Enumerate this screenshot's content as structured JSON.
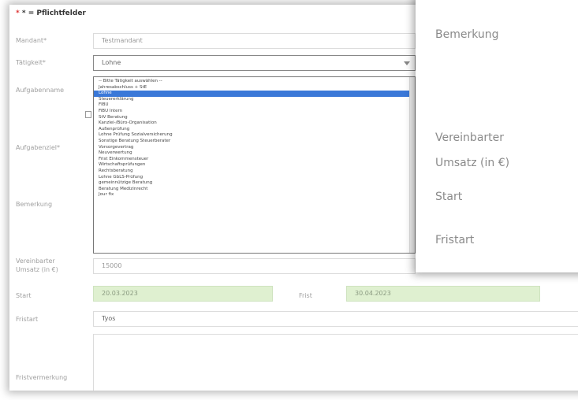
{
  "form": {
    "required_note": "* = Pflichtfelder",
    "labels": {
      "mandant": "Mandant*",
      "taetigkeit": "Tätigkeit*",
      "aufgabenname": "Aufgabenname",
      "aufgabenziel": "Aufgabenziel*",
      "bemerkung": "Bemerkung",
      "umsatz": "Vereinbarter Umsatz (in €)",
      "start": "Start",
      "fristart": "Fristart",
      "fristvermerkung": "Fristvermerkung"
    },
    "values": {
      "mandant": "Testmandant",
      "taetigkeit": "Lohne",
      "umsatz": "15000",
      "start": "20.03.2023",
      "frist_label": "Frist",
      "frist": "30.04.2023",
      "fristart": "Tyos"
    }
  },
  "dropdown": {
    "selected_index": 2,
    "options": [
      "-- Bitte Tätigkeit auswählen --",
      "Jahresabschluss + StE",
      "Lohne",
      "Steuererklärung",
      "FIBU",
      "FiBU Intern",
      "StV Beratung",
      "Kanzlei-/Büro-Organisation",
      "Außenprüfung",
      "Lohne Prüfung Sozialversicherung",
      "Sonstige Beratung Steuerberater",
      "Vorsorgevertrag",
      "Neuverwertung",
      "Frist Einkommensteuer",
      "Wirtschaftsprüfungen",
      "Rechtsberatung",
      "Lohne GbLS-Prüfung",
      "gemeinnützige Beratung",
      "Beratung Medizinrecht",
      "Jour fix"
    ]
  },
  "zoom": {
    "bemerkung": "Bemerkung",
    "umsatz_line1": "Vereinbarter",
    "umsatz_line2": "Umsatz (in €)",
    "start": "Start",
    "fristart": "Fristart"
  }
}
